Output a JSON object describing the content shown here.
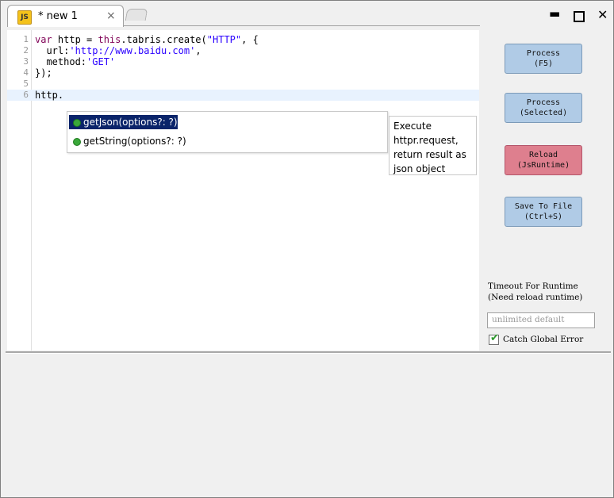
{
  "tab": {
    "icon_text": "JS",
    "title": "* new 1",
    "close_glyph": "×"
  },
  "window_controls": {
    "minimize": "▬",
    "close": "✕"
  },
  "editor": {
    "lines": [
      {
        "n": "1",
        "html": "<span class=\"kw\">var</span> http = <span class=\"kw\">this</span>.tabris.create(<span class=\"str\">\"HTTP\"</span>, {"
      },
      {
        "n": "2",
        "html": "  url:<span class=\"str\">'http://www.baidu.com'</span>,"
      },
      {
        "n": "3",
        "html": "  method:<span class=\"str\">'GET'</span>"
      },
      {
        "n": "4",
        "html": "});"
      },
      {
        "n": "5",
        "html": ""
      },
      {
        "n": "6",
        "html": "http."
      }
    ]
  },
  "autocomplete": {
    "items": [
      "getJson(options?: ?)",
      "getString(options?: ?)"
    ],
    "tooltip": [
      "Execute",
      "httpr.request,",
      "return result as",
      "json object"
    ]
  },
  "buttons": {
    "process": [
      "Process",
      "(F5)"
    ],
    "process_selected": [
      "Process",
      "(Selected)"
    ],
    "reload": [
      "Reload",
      "(JsRuntime)"
    ],
    "save": [
      "Save To File",
      "(Ctrl+S)"
    ]
  },
  "timeout": {
    "label1": "Timeout For Runtime",
    "label2": "(Need reload runtime)",
    "placeholder": "unlimited default"
  },
  "catch_error": {
    "label": "Catch Global Error",
    "checked": true
  },
  "colors": {
    "button_blue": "#b0cbe6",
    "button_red": "#de7f8e",
    "selected_bg": "#0a246a"
  }
}
